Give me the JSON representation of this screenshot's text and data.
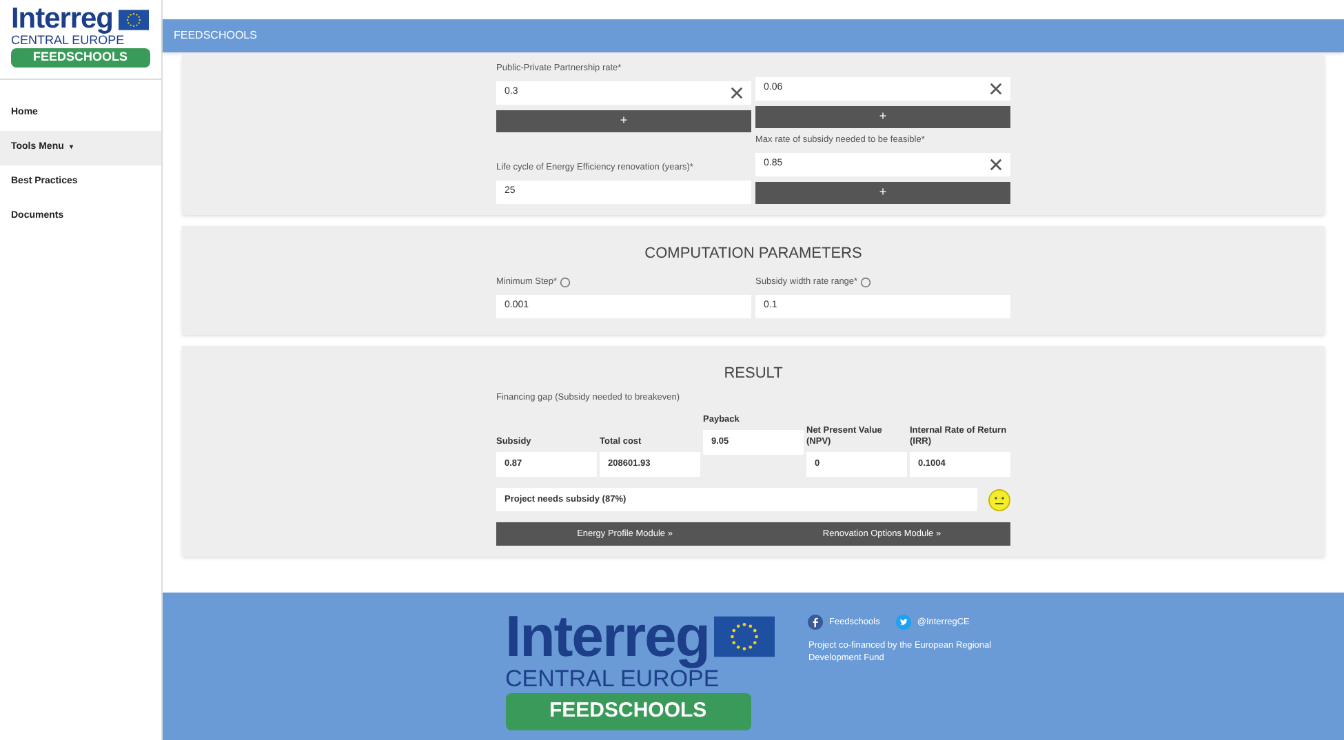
{
  "sidebar": {
    "logo": {
      "brand": "Interreg",
      "region": "CENTRAL EUROPE",
      "project": "FEEDSCHOOLS"
    },
    "items": [
      {
        "label": "Home",
        "selected": false
      },
      {
        "label": "Tools Menu",
        "selected": true,
        "caret": "▾"
      },
      {
        "label": "Best Practices",
        "selected": false
      },
      {
        "label": "Documents",
        "selected": false
      }
    ]
  },
  "header": {
    "title": "FEEDSCHOOLS"
  },
  "financing_panel": {
    "left": [
      {
        "kind": "label",
        "text": "Public-Private Partnership rate*"
      },
      {
        "kind": "clearable",
        "value": "0.3"
      },
      {
        "kind": "button",
        "text": "+"
      },
      {
        "kind": "spacer"
      },
      {
        "kind": "label",
        "text": "Life cycle of Energy Efficiency renovation (years)*"
      },
      {
        "kind": "plain",
        "value": "25"
      }
    ],
    "right": [
      {
        "kind": "spacer"
      },
      {
        "kind": "clearable",
        "value": "0.06"
      },
      {
        "kind": "button",
        "text": "+"
      },
      {
        "kind": "label",
        "text": "Max rate of subsidy needed to be feasible*"
      },
      {
        "kind": "clearable",
        "value": "0.85"
      },
      {
        "kind": "button",
        "text": "+"
      }
    ]
  },
  "computation_parameters": {
    "title": "COMPUTATION PARAMETERS",
    "fields": [
      {
        "label": "Minimum Step*",
        "value": "0.001",
        "help": true
      },
      {
        "label": "Subsidy width rate range*",
        "value": "0.1",
        "help": true
      }
    ]
  },
  "result": {
    "title": "RESULT",
    "subtitle": "Financing gap (Subsidy needed to breakeven)",
    "fields": [
      {
        "label": "Subsidy",
        "value": "0.87",
        "raised": false
      },
      {
        "label": "Total cost",
        "value": "208601.93",
        "raised": false
      },
      {
        "label": "Payback",
        "value": "9.05",
        "raised": true
      },
      {
        "label": "Net Present Value (NPV)",
        "value": "0",
        "raised": false
      },
      {
        "label": "Internal Rate of Return (IRR)",
        "value": "0.1004",
        "raised": false
      }
    ],
    "message": "Project needs subsidy (87%)",
    "links": [
      "Energy Profile Module »",
      "Renovation Options Module »"
    ]
  },
  "footer": {
    "logo": {
      "brand": "Interreg",
      "region": "CENTRAL EUROPE",
      "project": "FEEDSCHOOLS"
    },
    "social": [
      {
        "kind": "facebook",
        "label": "Feedschools"
      },
      {
        "kind": "twitter",
        "label": "@InterregCE"
      }
    ],
    "note": "Project co-financed by the European Regional Development Fund"
  }
}
